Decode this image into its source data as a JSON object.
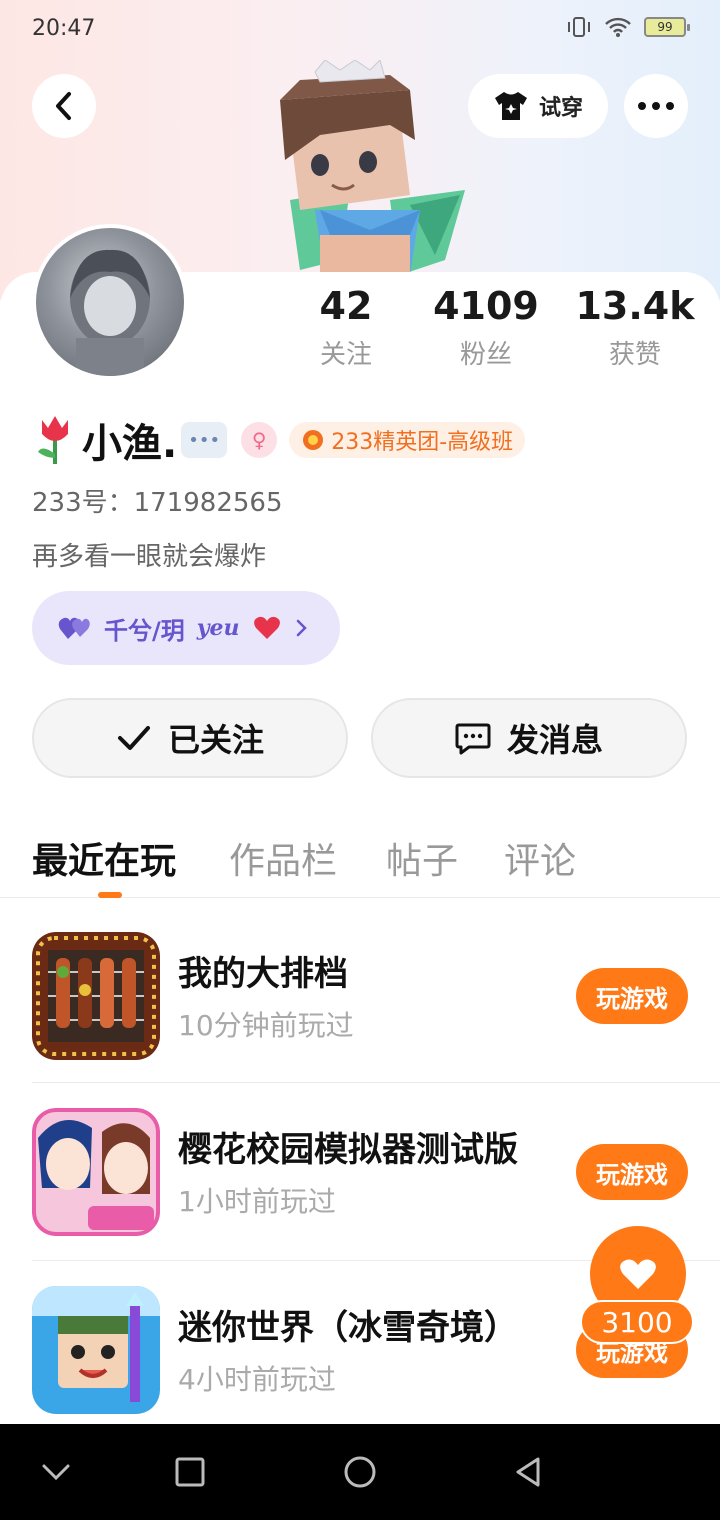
{
  "status_bar": {
    "time": "20:47",
    "battery": "99"
  },
  "header": {
    "try_on_label": "试穿"
  },
  "stats": [
    {
      "value": "42",
      "label": "关注"
    },
    {
      "value": "4109",
      "label": "粉丝"
    },
    {
      "value": "13.4k",
      "label": "获赞"
    }
  ],
  "profile": {
    "name": "小渔.",
    "tag": "233精英团-高级班",
    "user_id": "233号：171982565",
    "bio": "再多看一眼就会爆炸",
    "cp_name": "千兮/玥"
  },
  "actions": {
    "follow_label": "已关注",
    "message_label": "发消息"
  },
  "tabs": [
    {
      "label": "最近在玩"
    },
    {
      "label": "作品栏"
    },
    {
      "label": "帖子"
    },
    {
      "label": "评论"
    }
  ],
  "games": [
    {
      "name": "我的大排档",
      "time": "10分钟前玩过",
      "button": "玩游戏"
    },
    {
      "name": "樱花校园模拟器测试版",
      "time": "1小时前玩过",
      "button": "玩游戏"
    },
    {
      "name": "迷你世界（冰雪奇境）",
      "time": "4小时前玩过",
      "button": "玩游戏"
    }
  ],
  "floating_like": {
    "count": "3100"
  },
  "colors": {
    "accent": "#ff7a17",
    "cp_bg": "#e9e6fc",
    "cp_text": "#6655cc"
  }
}
